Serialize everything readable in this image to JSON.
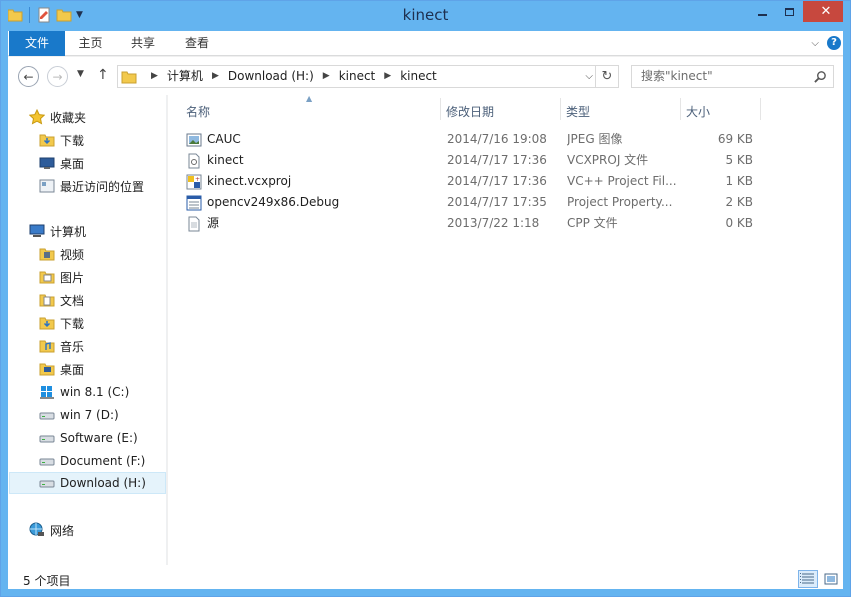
{
  "window": {
    "title": "kinect",
    "colors": {
      "frame": "#64b4f0",
      "close": "#c7483e",
      "file_tab": "#1979ca"
    }
  },
  "ribbon": {
    "tabs": [
      "文件",
      "主页",
      "共享",
      "查看"
    ],
    "help_glyph": "?"
  },
  "address": {
    "path": [
      "计算机",
      "Download (H:)",
      "kinect",
      "kinect"
    ]
  },
  "search": {
    "placeholder": "搜索\"kinect\""
  },
  "nav": {
    "favorites": {
      "label": "收藏夹",
      "items": [
        "下载",
        "桌面",
        "最近访问的位置"
      ]
    },
    "computer": {
      "label": "计算机",
      "items": [
        "视频",
        "图片",
        "文档",
        "下载",
        "音乐",
        "桌面",
        "win 8.1 (C:)",
        "win 7 (D:)",
        "Software (E:)",
        "Document (F:)",
        "Download (H:)"
      ]
    },
    "network": {
      "label": "网络"
    },
    "selected": "Download (H:)"
  },
  "columns": {
    "name": "名称",
    "date": "修改日期",
    "type": "类型",
    "size": "大小"
  },
  "files": [
    {
      "name": "CAUC",
      "date": "2014/7/16 19:08",
      "type": "JPEG 图像",
      "size": "69 KB",
      "icon": "image-file-icon"
    },
    {
      "name": "kinect",
      "date": "2014/7/17 17:36",
      "type": "VCXPROJ 文件",
      "size": "5 KB",
      "icon": "vcxproj-file-icon"
    },
    {
      "name": "kinect.vcxproj",
      "date": "2014/7/17 17:36",
      "type": "VC++ Project Fil...",
      "size": "1 KB",
      "icon": "vcproject-file-icon"
    },
    {
      "name": "opencv249x86.Debug",
      "date": "2014/7/17 17:35",
      "type": "Project Property...",
      "size": "2 KB",
      "icon": "property-sheet-file-icon"
    },
    {
      "name": "源",
      "date": "2013/7/22 1:18",
      "type": "CPP 文件",
      "size": "0 KB",
      "icon": "cpp-file-icon"
    }
  ],
  "status": {
    "text": "5 个项目"
  }
}
